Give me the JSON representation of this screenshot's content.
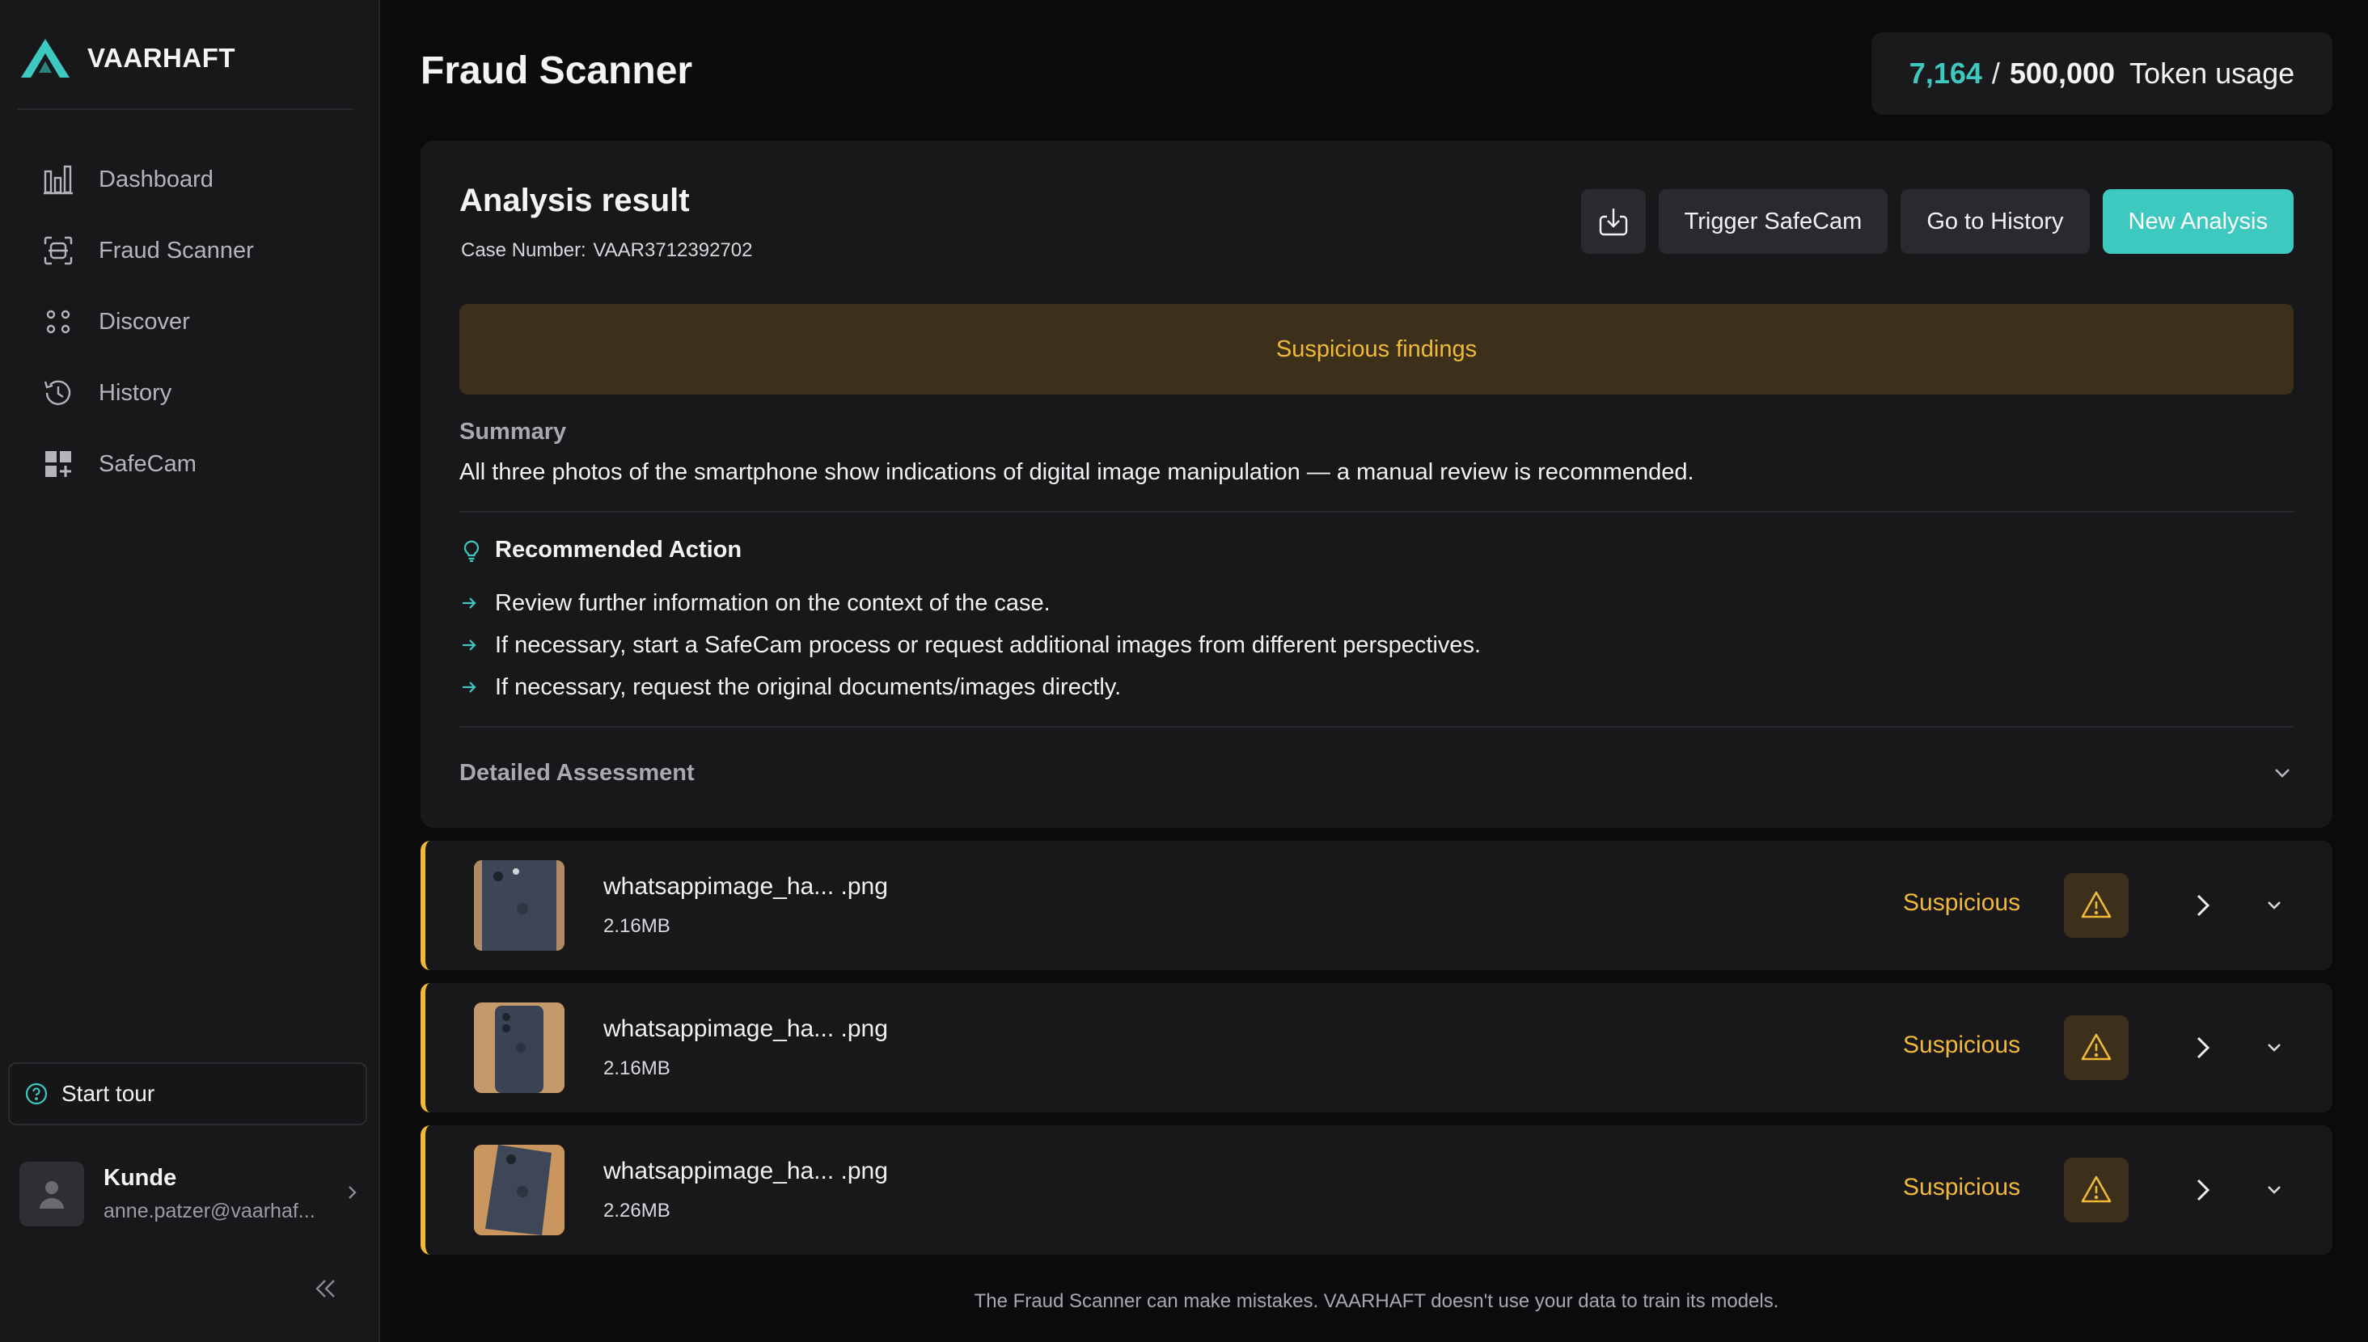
{
  "app": {
    "brand": "VAARHAFT",
    "accent": "#3ec9c0",
    "warning": "#f0b93a"
  },
  "sidebar": {
    "items": [
      {
        "label": "Dashboard",
        "icon": "bar-chart-icon"
      },
      {
        "label": "Fraud Scanner",
        "icon": "scan-icon"
      },
      {
        "label": "Discover",
        "icon": "dots-grid-icon"
      },
      {
        "label": "History",
        "icon": "history-icon"
      },
      {
        "label": "SafeCam",
        "icon": "grid-plus-icon"
      }
    ],
    "tour_label": "Start tour",
    "user": {
      "name": "Kunde",
      "email": "anne.patzer@vaarhaf..."
    }
  },
  "header": {
    "title": "Fraud Scanner",
    "tokens": {
      "used": "7,164",
      "separator": "/",
      "total": "500,000",
      "label": "Token usage"
    }
  },
  "analysis": {
    "title": "Analysis result",
    "case_label": "Case Number:",
    "case_number": "VAAR3712392702",
    "actions": {
      "trigger": "Trigger SafeCam",
      "history": "Go to History",
      "new": "New Analysis"
    },
    "alert": "Suspicious findings",
    "summary_label": "Summary",
    "summary": "All three photos of the smartphone show indications of digital image manipulation — a manual review is recommended.",
    "recommended_title": "Recommended Action",
    "recommended": [
      "Review further information on the context of the case.",
      "If necessary, start a SafeCam process or request additional images from different perspectives.",
      "If necessary, request the original documents/images directly."
    ],
    "detailed_label": "Detailed Assessment"
  },
  "files": [
    {
      "name": "whatsappimage_ha... .png",
      "size": "2.16MB",
      "status": "Suspicious"
    },
    {
      "name": "whatsappimage_ha... .png",
      "size": "2.16MB",
      "status": "Suspicious"
    },
    {
      "name": "whatsappimage_ha... .png",
      "size": "2.26MB",
      "status": "Suspicious"
    }
  ],
  "footer": "The Fraud Scanner can make mistakes. VAARHAFT doesn't use your data to train its models."
}
